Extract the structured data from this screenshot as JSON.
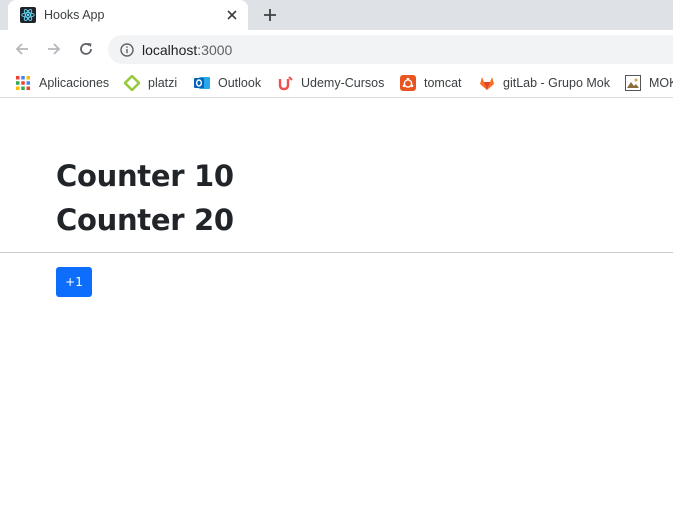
{
  "browser": {
    "tab": {
      "title": "Hooks App",
      "favicon": "react-logo-icon"
    },
    "address_bar": {
      "host": "localhost",
      "port": ":3000"
    },
    "bookmarks": [
      {
        "label": "Aplicaciones",
        "icon": "apps-grid-icon"
      },
      {
        "label": "platzi",
        "icon": "platzi-icon"
      },
      {
        "label": "Outlook",
        "icon": "outlook-icon"
      },
      {
        "label": "Udemy-Cursos",
        "icon": "udemy-icon"
      },
      {
        "label": "tomcat",
        "icon": "ubuntu-icon"
      },
      {
        "label": "gitLab - Grupo Mok",
        "icon": "gitlab-icon"
      },
      {
        "label": "MOK",
        "icon": "image-icon"
      }
    ]
  },
  "page": {
    "counter1": "Counter 10",
    "counter2": "Counter 20",
    "increment_button": "+1"
  },
  "colors": {
    "tab_strip": "#dee1e6",
    "omnibox": "#f1f3f4",
    "heading": "#212529",
    "button_primary": "#0d6efd"
  }
}
